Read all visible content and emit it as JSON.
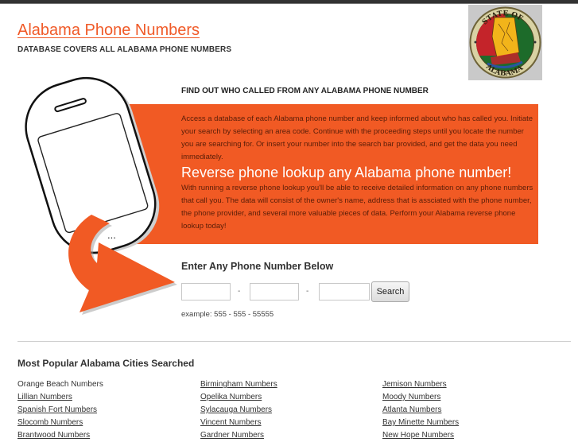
{
  "header": {
    "site_title": "Alabama Phone Numbers",
    "tagline": "DATABASE COVERS ALL ALABAMA PHONE NUMBERS",
    "seal": {
      "top_text": "STATE OF",
      "bottom_text": "ALABAMA"
    }
  },
  "hero": {
    "headline": "FIND OUT WHO CALLED FROM ANY ALABAMA PHONE NUMBER",
    "intro": "Access a database of each Alabama phone number and keep informed about who has called you. Initiate your search by selecting an area code. Continue with the proceeding steps until you locate the number you are searching for. Or insert your number into the search bar provided, and get the data you need immediately.",
    "heading": "Reverse phone lookup any Alabama phone number!",
    "body": "With running a reverse phone lookup you'll be able to receive detailed information on any phone numbers that call you. The data will consist of the owner's name, address that is assciated with the phone number, the phone provider, and several more valuable pieces of data. Perform your Alabama reverse phone lookup today!",
    "phone_dots": "..."
  },
  "search_form": {
    "title": "Enter Any Phone Number Below",
    "area_code_value": "",
    "prefix_value": "",
    "line_value": "",
    "separator": "-",
    "search_label": "Search",
    "example": "example: 555 - 555 - 55555"
  },
  "cities": {
    "title": "Most Popular Alabama Cities Searched",
    "columns": [
      [
        "Orange Beach Numbers",
        "Lillian Numbers",
        "Spanish Fort Numbers",
        "Slocomb Numbers",
        "Brantwood Numbers"
      ],
      [
        "Birmingham Numbers",
        "Opelika Numbers",
        "Sylacauga Numbers",
        "Vincent Numbers",
        "Gardner Numbers"
      ],
      [
        "Jemison Numbers",
        "Moody Numbers",
        "Atlanta Numbers",
        "Bay Minette Numbers",
        "New Hope Numbers"
      ]
    ],
    "first_item_is_link": false
  },
  "colors": {
    "accent": "#f15a24",
    "title": "#f05a28",
    "topbar": "#333333"
  }
}
